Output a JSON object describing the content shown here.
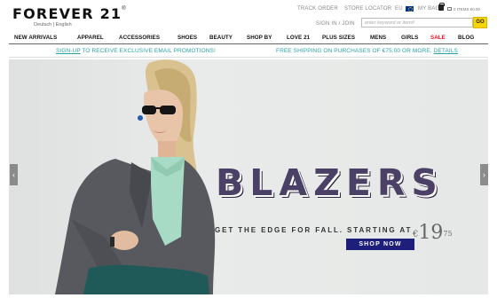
{
  "header": {
    "logo": "FOREVER 21",
    "logo_mark": "®",
    "lang_1": "Deutsch",
    "lang_sep": "|",
    "lang_2": "English",
    "track_order": "TRACK ORDER",
    "store_locator": "STORE LOCATOR",
    "region": "EU",
    "my_bag": "MY BAG",
    "items": "0 ITEMS €0.00",
    "sign_in": "SIGN IN / JOIN",
    "search_placeholder": "enter keyword or item#",
    "go": "GO"
  },
  "nav": {
    "items": [
      "NEW ARRIVALS",
      "APPAREL",
      "ACCESSORIES",
      "SHOES",
      "BEAUTY",
      "SHOP BY",
      "LOVE 21",
      "PLUS SIZES",
      "MENS",
      "GIRLS",
      "SALE",
      "BLOG"
    ]
  },
  "promo": {
    "signup_link": "SIGN-UP",
    "signup_text": " TO RECEIVE EXCLUSIVE EMAIL PROMOTIONS!",
    "shipping_text": "FREE SHIPPING ON PURCHASES OF €75.00 OR MORE. ",
    "details_link": "DETAILS"
  },
  "hero": {
    "headline": "BLAZERS",
    "tagline": "GET THE EDGE FOR FALL. STARTING AT",
    "price_symbol": "€",
    "price_whole": "19",
    "price_cents": "75",
    "cta": "SHOP NOW"
  },
  "colors": {
    "accent_teal": "#2ba2a6",
    "sale_red": "#e8141b",
    "headline_purple": "#4b4167",
    "cta_navy": "#1d1f7a",
    "go_yellow": "#f5d400"
  }
}
